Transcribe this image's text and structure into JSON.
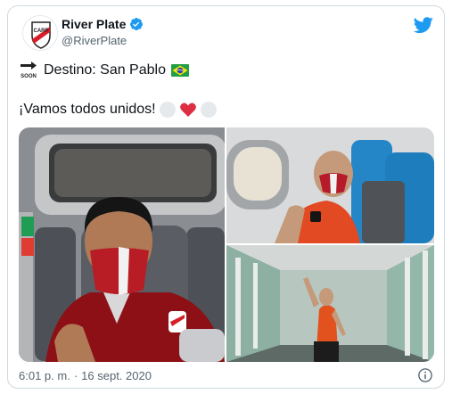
{
  "tweet": {
    "display_name": "River Plate",
    "handle": "@RiverPlate",
    "verified": true,
    "line1_text": "Destino: San Pablo",
    "line1_lead_icon": "soon-arrow-icon",
    "line1_trail_icon": "brazil-flag-icon",
    "line2_text": "¡Vamos todos unidos!",
    "line2_emojis": [
      "white-circle-icon",
      "red-heart-icon",
      "white-circle-icon"
    ],
    "time": "6:01 p. m.",
    "separator": "·",
    "date": "16 sept. 2020"
  },
  "icons": {
    "soon_label": "SOON"
  },
  "colors": {
    "twitter_blue": "#1d9bf0",
    "club_red": "#d71e28",
    "text_secondary": "#536471"
  }
}
